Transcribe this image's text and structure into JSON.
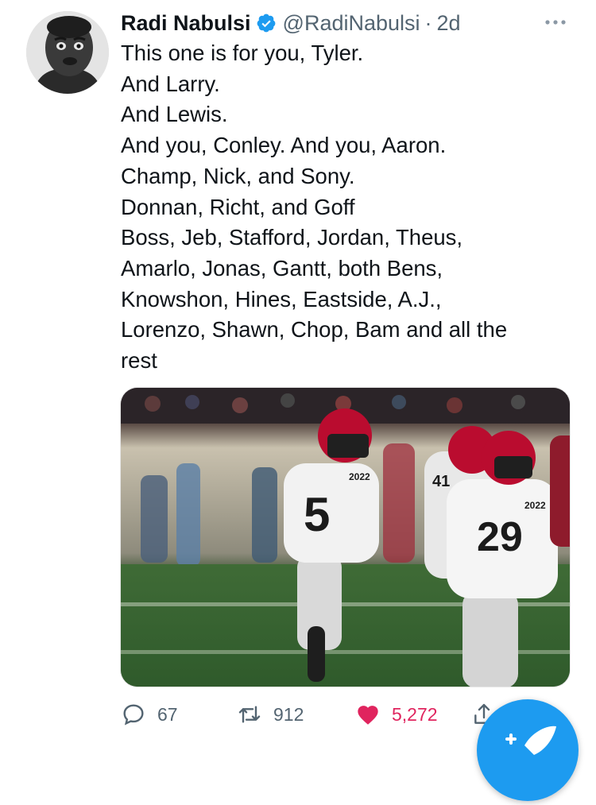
{
  "tweet": {
    "author_name": "Radi Nabulsi",
    "handle": "@RadiNabulsi",
    "separator": "·",
    "time": "2d",
    "text_lines": [
      "This one is for you, Tyler.",
      "And Larry.",
      "And Lewis.",
      "And you, Conley. And you, Aaron.",
      "Champ, Nick, and Sony.",
      "Donnan, Richt, and Goff",
      "Boss, Jeb, Stafford, Jordan, Theus,",
      "Amarlo, Jonas, Gantt, both Bens,",
      "Knowshon, Hines, Eastside, A.J.,",
      "Lorenzo, Shawn, Chop, Bam and all the",
      "rest"
    ],
    "media": {
      "jersey_numbers": [
        "5",
        "41",
        "29"
      ],
      "patch_text": "2022"
    }
  },
  "actions": {
    "reply_count": "67",
    "retweet_count": "912",
    "like_count": "5,272"
  },
  "icons": {
    "verified": "verified-badge-icon",
    "more": "more-options-icon",
    "reply": "reply-icon",
    "retweet": "retweet-icon",
    "like": "heart-icon",
    "share": "share-icon",
    "compose": "compose-icon"
  },
  "colors": {
    "verified_blue": "#1d9bf0",
    "like_red": "#e0245e",
    "muted_text": "#536471",
    "jersey_red": "#ba0c2f"
  }
}
